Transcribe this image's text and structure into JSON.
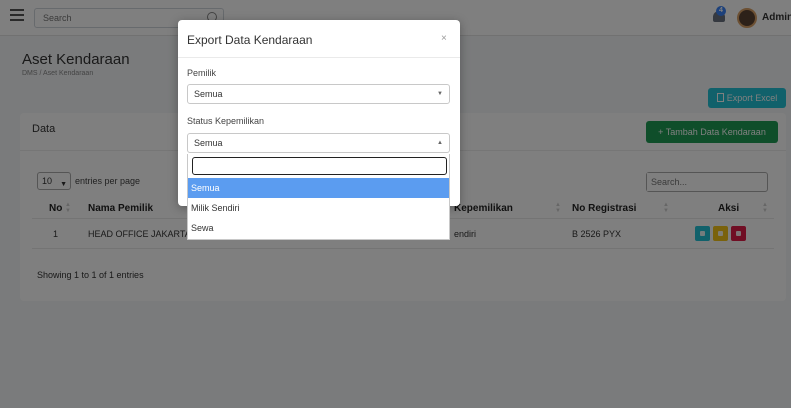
{
  "topbar": {
    "search_placeholder": "Search",
    "notification_count": "4",
    "user_name": "Admin"
  },
  "page": {
    "title": "Aset Kendaraan",
    "breadcrumb": "DMS / Aset Kendaraan",
    "export_button": "Export Excel"
  },
  "card": {
    "title": "Data",
    "add_button": "+ Tambah Data Kendaraan",
    "length_value": "10",
    "length_label": "entries per page",
    "search_placeholder": "Search...",
    "columns": [
      "No",
      "Nama Pemilik",
      "Kepemilikan",
      "No Registrasi",
      "Aksi"
    ],
    "rows": [
      {
        "no": "1",
        "nama_pemilik": "HEAD OFFICE JAKARTA",
        "kepemilikan": "endiri",
        "no_registrasi": "B 2526 PYX"
      }
    ],
    "entries_info": "Showing 1 to 1 of 1 entries"
  },
  "modal": {
    "title": "Export Data Kendaraan",
    "close_glyph": "×",
    "pemilik_label": "Pemilik",
    "pemilik_value": "Semua",
    "status_label": "Status Kepemilikan",
    "status_value": "Semua",
    "options": [
      "Semua",
      "Milik Sendiri",
      "Sewa"
    ],
    "selected_option": "Semua"
  },
  "colors": {
    "primary_cyan": "#22c3d6",
    "success_green": "#1f9d55",
    "selected_option": "#5b9cf0",
    "danger": "#e11d48",
    "warning": "#f5c518"
  },
  "icons": [
    "menu-icon",
    "search-icon",
    "bell-icon",
    "file-icon",
    "view-icon",
    "edit-icon",
    "delete-icon",
    "close-icon",
    "chevron-down-icon",
    "chevron-up-icon"
  ]
}
